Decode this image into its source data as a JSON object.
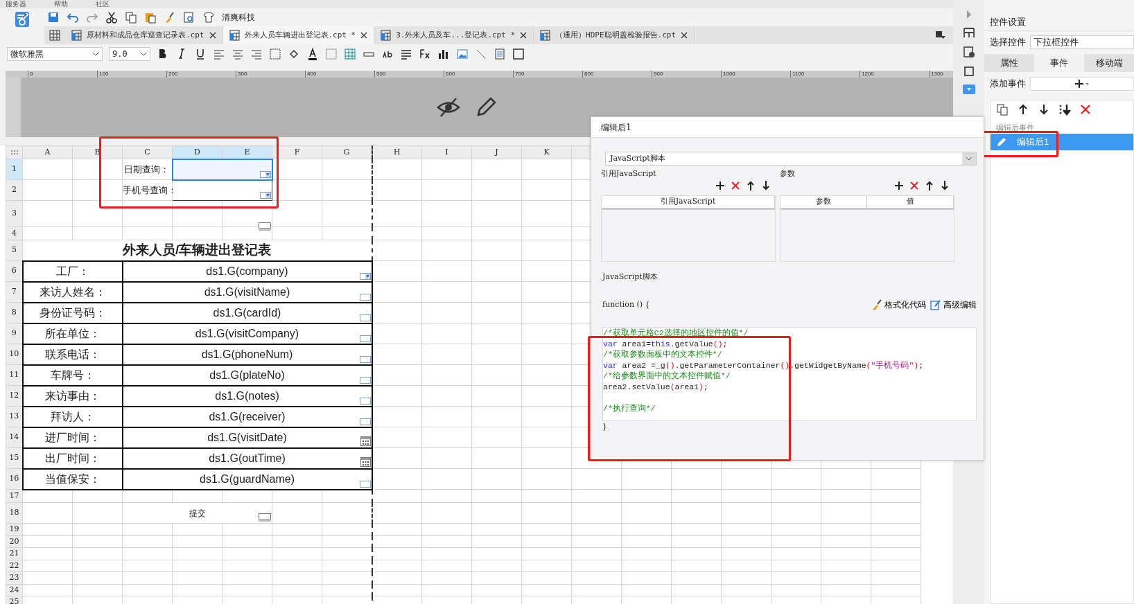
{
  "menu": [
    "服务器",
    "帮助",
    "社区"
  ],
  "toolbar": {
    "brand": "清爽科技"
  },
  "tabs": [
    {
      "label": "原材料和成品仓库巡查记录表.cpt",
      "selected": false
    },
    {
      "label": "外来人员车辆进出登记表.cpt *",
      "selected": true
    },
    {
      "label": "3.外来人员及车...登记表.cpt *",
      "selected": false
    },
    {
      "label": "（通用）HDPE聪明盖检验报告.cpt",
      "selected": false
    }
  ],
  "format_bar": {
    "font": "微软雅黑",
    "size": "9.0"
  },
  "ruler": [
    "0",
    "100",
    "200",
    "300",
    "400",
    "500",
    "600",
    "700",
    "800",
    "900",
    "1000",
    "1100",
    "1200",
    "1300"
  ],
  "sheet": {
    "columns": [
      "A",
      "B",
      "C",
      "D",
      "E",
      "F",
      "G",
      "H",
      "I",
      "J",
      "K"
    ],
    "row_numbers": [
      "1",
      "2",
      "3",
      "4",
      "5",
      "6",
      "7",
      "8",
      "9",
      "10",
      "11",
      "12",
      "13",
      "14",
      "15",
      "16",
      "17",
      "18",
      "19",
      "20",
      "21",
      "22",
      "23",
      "24",
      "25"
    ],
    "query_highlighted": true,
    "query_fields": [
      {
        "label": "日期查询：",
        "selected": true
      },
      {
        "label": "手机号查询：",
        "selected": false
      }
    ],
    "title": "外来人员/车辆进出登记表",
    "form_rows": [
      {
        "label": "工厂：",
        "value": "ds1.G(company)",
        "kind": "dropdown"
      },
      {
        "label": "来访人姓名：",
        "value": "ds1.G(visitName)",
        "kind": "text"
      },
      {
        "label": "身份证号码：",
        "value": "ds1.G(cardId)",
        "kind": "text"
      },
      {
        "label": "所在单位：",
        "value": "ds1.G(visitCompany)",
        "kind": "text"
      },
      {
        "label": "联系电话：",
        "value": "ds1.G(phoneNum)",
        "kind": "text"
      },
      {
        "label": "车牌号：",
        "value": "ds1.G(plateNo)",
        "kind": "text"
      },
      {
        "label": "来访事由：",
        "value": "ds1.G(notes)",
        "kind": "text"
      },
      {
        "label": "拜访人：",
        "value": "ds1.G(receiver)",
        "kind": "text"
      },
      {
        "label": "进厂时间：",
        "value": "ds1.G(visitDate)",
        "kind": "date"
      },
      {
        "label": "出厂时间：",
        "value": "ds1.G(outTime)",
        "kind": "date"
      },
      {
        "label": "当值保安：",
        "value": "ds1.G(guardName)",
        "kind": "text"
      }
    ],
    "submit": "提交"
  },
  "dialog": {
    "title": "编辑后1",
    "type_select": "JavaScript脚本",
    "ref_section": "引用JavaScript",
    "ref_columns": [
      "引用JavaScript"
    ],
    "param_section": "参数",
    "param_columns": [
      "参数",
      "值"
    ],
    "script_section": "JavaScript脚本",
    "function_open": "function () {",
    "format_button": "格式化代码",
    "advanced_button": "高级编辑",
    "code_highlighted": true,
    "code": [
      [
        {
          "kind": "comment",
          "text": "/*获取单元格C2选择的地区控件的值*/"
        }
      ],
      [
        {
          "kind": "keyword",
          "text": "var"
        },
        {
          "kind": "plain",
          "text": " area1="
        },
        {
          "kind": "keyword",
          "text": "this"
        },
        {
          "kind": "plain",
          "text": ".getValue"
        },
        {
          "kind": "paren",
          "text": "()"
        },
        {
          "kind": "plain",
          "text": ";"
        }
      ],
      [
        {
          "kind": "comment",
          "text": "/*获取参数面板中的文本控件*/"
        }
      ],
      [
        {
          "kind": "keyword",
          "text": "var"
        },
        {
          "kind": "plain",
          "text": " area2 =_g"
        },
        {
          "kind": "paren",
          "text": "()"
        },
        {
          "kind": "plain",
          "text": ".getParameterContainer"
        },
        {
          "kind": "paren",
          "text": "()"
        },
        {
          "kind": "plain",
          "text": ".getWidgetByName"
        },
        {
          "kind": "paren",
          "text": "("
        },
        {
          "kind": "string",
          "text": "\"手机号码\""
        },
        {
          "kind": "paren",
          "text": ")"
        },
        {
          "kind": "plain",
          "text": ";"
        }
      ],
      [
        {
          "kind": "comment",
          "text": "/*给参数界面中的文本控件赋值*/"
        }
      ],
      [
        {
          "kind": "plain",
          "text": "area2.setValue"
        },
        {
          "kind": "paren",
          "text": "("
        },
        {
          "kind": "plain",
          "text": "area1"
        },
        {
          "kind": "paren",
          "text": ")"
        },
        {
          "kind": "plain",
          "text": ";"
        }
      ],
      [
        {
          "kind": "comment",
          "text": "/*执行查询*/"
        }
      ]
    ],
    "code_gap_before_last": true,
    "function_close": "}"
  },
  "panel": {
    "title": "控件设置",
    "select_label": "选择控件",
    "select_value": "下拉框控件",
    "tabs": [
      {
        "label": "属性",
        "selected": false
      },
      {
        "label": "事件",
        "selected": true
      },
      {
        "label": "移动端",
        "selected": false
      }
    ],
    "add_label": "添加事件",
    "event_group": "编辑后事件",
    "events": [
      {
        "label": "编辑后1",
        "selected": true,
        "highlighted": true
      }
    ]
  }
}
